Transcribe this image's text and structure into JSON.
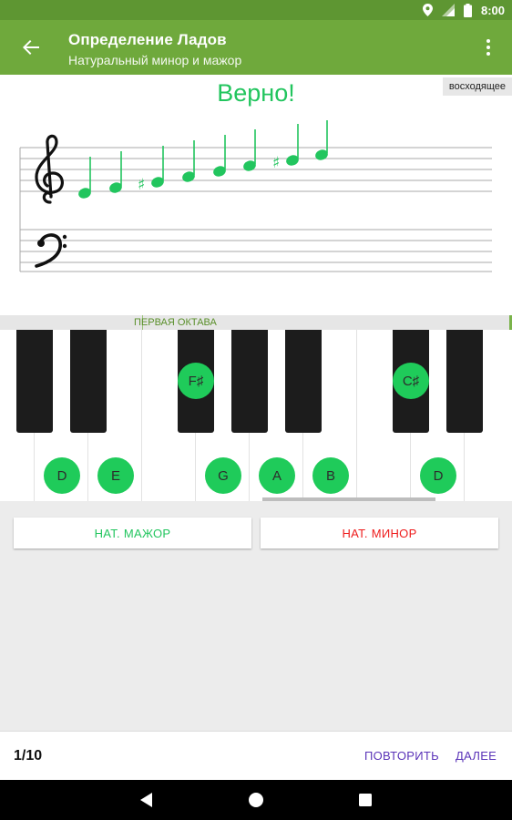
{
  "status_bar": {
    "time": "8:00",
    "icons": [
      "location-icon",
      "signal-icon",
      "battery-icon"
    ]
  },
  "app_bar": {
    "title": "Определение Ладов",
    "subtitle": "Натуральный минор и мажор",
    "back_icon": "arrow-back-icon",
    "menu_icon": "more-vert-icon"
  },
  "staff": {
    "direction": "восходящее",
    "result": "Верно!",
    "notes": [
      "D",
      "E",
      "F#",
      "G",
      "A",
      "B",
      "C#",
      "D"
    ],
    "clefs": [
      "treble-clef-icon",
      "bass-clef-icon"
    ]
  },
  "keyboard": {
    "octave_label": "ПЕРВАЯ ОКТАВА",
    "white_labels": {
      "d1": "D",
      "e1": "E",
      "g1": "G",
      "a1": "A",
      "b1": "B",
      "d2": "D"
    },
    "black_labels": {
      "fsharp": "F♯",
      "csharp": "C♯"
    }
  },
  "answers": {
    "major": "НАТ. МАЖОР",
    "minor": "НАТ. МИНОР"
  },
  "footer": {
    "counter": "1/10",
    "repeat": "ПОВТОРИТЬ",
    "next": "ДАЛЕЕ"
  },
  "colors": {
    "app_bar": "#6fa93c",
    "status_bar": "#5e9632",
    "correct": "#22c55e",
    "wrong": "#ee1c1c",
    "note_dot": "#1fcb5a",
    "action": "#5a33b8"
  },
  "system_nav": [
    "back-triangle-icon",
    "home-circle-icon",
    "recents-square-icon"
  ]
}
